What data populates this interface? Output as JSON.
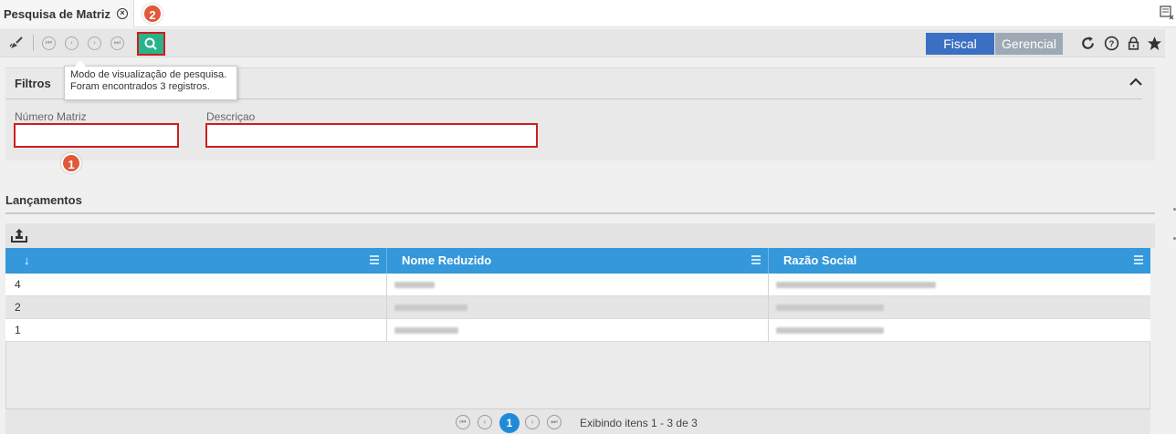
{
  "tab": {
    "title": "Pesquisa de Matriz",
    "close_symbol": "×"
  },
  "callouts": {
    "first": "1",
    "second": "2"
  },
  "toolbar": {
    "nav": {
      "first": "⏮",
      "prev": "‹",
      "next": "›",
      "last": "⏭"
    },
    "fiscal_label": "Fiscal",
    "gerencial_label": "Gerencial"
  },
  "tooltip": {
    "line1": "Modo de visualização de pesquisa.",
    "line2": "Foram encontrados 3 registros."
  },
  "filters": {
    "title": "Filtros",
    "numero_label": "Número Matriz",
    "numero_value": "",
    "descricao_label": "Descriçao",
    "descricao_value": ""
  },
  "lancamentos": {
    "title": "Lançamentos",
    "columns": [
      "↓",
      "Nome Reduzido",
      "Razão Social"
    ],
    "rows": [
      {
        "id": "4"
      },
      {
        "id": "2"
      },
      {
        "id": "1"
      }
    ]
  },
  "pager": {
    "current_page": "1",
    "info": "Exibindo itens 1 - 3 de 3"
  },
  "colors": {
    "accent_blue": "#3498db",
    "fiscal_blue": "#3a6fc3",
    "search_green": "#2ab38a",
    "highlight_red": "#cc1f1f",
    "callout_orange": "#e0593a"
  }
}
